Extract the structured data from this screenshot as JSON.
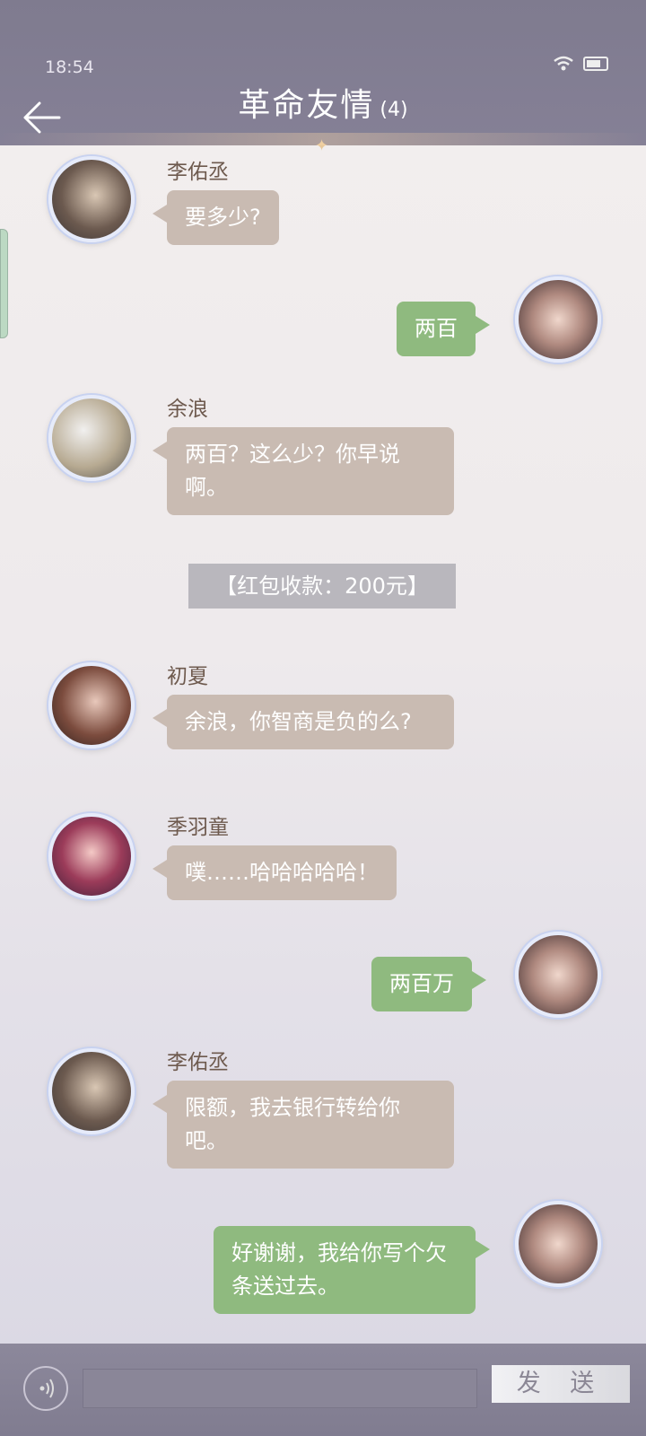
{
  "status": {
    "time": "18:54"
  },
  "header": {
    "title": "革命友情",
    "count": "(4)"
  },
  "messages": [
    {
      "sender": "李佑丞",
      "text": "要多少?"
    },
    {
      "text": "两百"
    },
    {
      "sender": "余浪",
      "text": "两百？这么少？你早说啊。"
    },
    {
      "system": "【红包收款：200元】"
    },
    {
      "sender": "初夏",
      "text": "余浪，你智商是负的么?"
    },
    {
      "sender": "季羽童",
      "text": "噗……哈哈哈哈哈！"
    },
    {
      "text": "两百万"
    },
    {
      "sender": "李佑丞",
      "text": "限额，我去银行转给你吧。"
    },
    {
      "text": "好谢谢，我给你写个欠条送过去。"
    }
  ],
  "footer": {
    "send_label": "发 送"
  },
  "colors": {
    "header": "#7f7b8f",
    "left_bubble": "#c9bbb2",
    "right_bubble": "#8fba7f"
  }
}
